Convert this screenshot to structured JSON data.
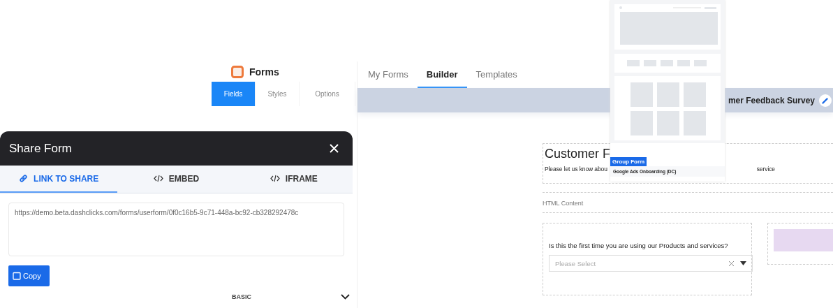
{
  "sidebar": {
    "title": "Forms",
    "tabs": [
      {
        "label": "Fields",
        "selected": true
      },
      {
        "label": "Styles",
        "selected": false
      },
      {
        "label": "Options",
        "selected": false
      }
    ],
    "section_label": "BASIC"
  },
  "nav_tabs": [
    {
      "label": "My Forms",
      "selected": false
    },
    {
      "label": "Builder",
      "selected": true
    },
    {
      "label": "Templates",
      "selected": false
    }
  ],
  "title_bar": {
    "title": "mer Feedback Survey"
  },
  "canvas": {
    "heading": "Customer F",
    "description": [
      "Please let us know abou",
      "service"
    ],
    "html_label": "HTML Content",
    "question": {
      "label": "Is this the first time you are using our Products and services?",
      "placeholder": "Please Select"
    }
  },
  "template_card": {
    "badge": "Group Form",
    "name": "Google Ads Onboarding (DC)"
  },
  "share_modal": {
    "title": "Share Form",
    "tabs": [
      {
        "label": "LINK TO SHARE",
        "kind": "link",
        "selected": true
      },
      {
        "label": "EMBED",
        "kind": "code",
        "selected": false
      },
      {
        "label": "IFRAME",
        "kind": "code",
        "selected": false
      }
    ],
    "url": "https://demo.beta.dashclicks.com/forms/userform/0f0c16b5-9c71-448a-bc92-cb328292478c",
    "button": "Copy"
  }
}
